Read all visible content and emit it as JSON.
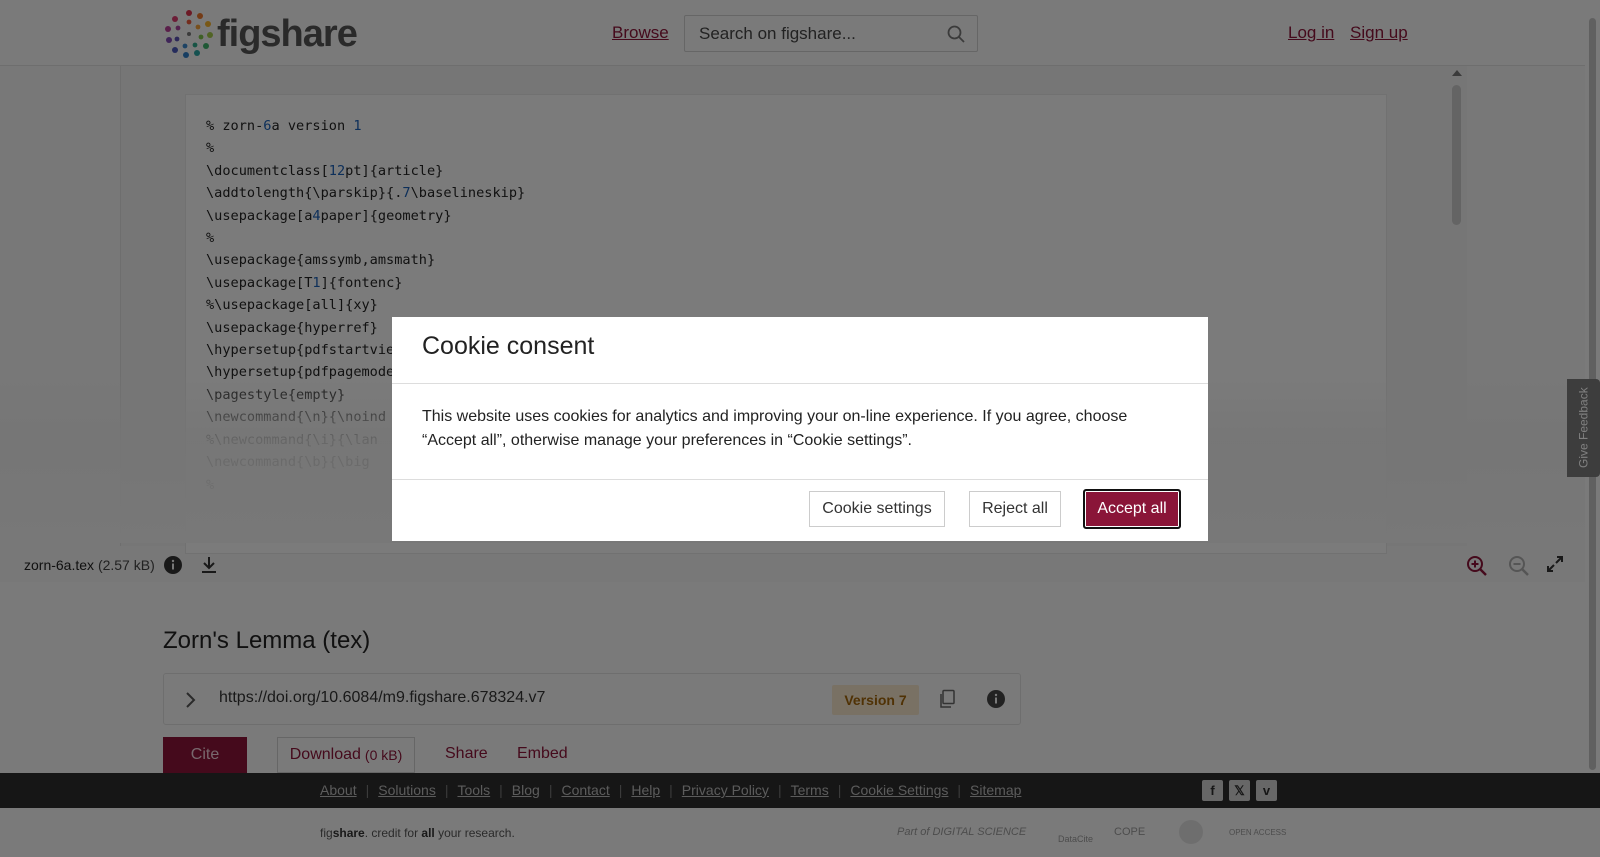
{
  "header": {
    "logo_text": "figshare",
    "browse": "Browse",
    "search_placeholder": "Search on figshare...",
    "login": "Log in",
    "signup": "Sign up"
  },
  "viewer": {
    "code_lines": [
      "% zorn-6a version 1",
      "%",
      "\\documentclass[12pt]{article}",
      "\\addtolength{\\parskip}{.7\\baselineskip}",
      "\\usepackage[a4paper]{geometry}",
      "%",
      "\\usepackage{amssymb,amsmath}",
      "\\usepackage[T1]{fontenc}",
      "%\\usepackage[all]{xy}",
      "\\usepackage{hyperref}",
      "\\hypersetup{pdfstartview",
      "\\hypersetup{pdfpagemode",
      "\\pagestyle{empty}",
      "\\newcommand{\\n}{\\noind",
      "%\\newcommand{\\i}{\\lan",
      "\\newcommand{\\b}{\\big",
      "%"
    ],
    "file_name": "zorn-6a.tex",
    "file_size": "(2.57 kB)"
  },
  "feedback": "Give Feedback",
  "item": {
    "title": "Zorn's Lemma (tex)",
    "doi": "https://doi.org/10.6084/m9.figshare.678324.v7",
    "version": "Version 7",
    "cite": "Cite",
    "download": "Download",
    "download_size": "(0 kB)",
    "share": "Share",
    "embed": "Embed"
  },
  "footer": {
    "links": [
      "About",
      "Solutions",
      "Tools",
      "Blog",
      "Contact",
      "Help",
      "Privacy Policy",
      "Terms",
      "Cookie Settings",
      "Sitemap"
    ],
    "tagline_fig": "fig",
    "tagline_share": "share",
    "tagline_mid": ". credit for ",
    "tagline_all": "all",
    "tagline_end": " your research.",
    "partner_ds": "Part of DIGITAL SCIENCE",
    "partner_datacite": "DataCite",
    "partner_cope": "COPE",
    "partner_oa": "OPEN ACCESS"
  },
  "cookie": {
    "title": "Cookie consent",
    "body": "This website uses cookies for analytics and improving your on-line experience. If you agree, choose “Accept all”, otherwise manage your preferences in “Cookie settings”.",
    "settings": "Cookie settings",
    "reject": "Reject all",
    "accept": "Accept all"
  },
  "colors": {
    "brand": "#8a1538",
    "version_bg": "#f3e3c8",
    "version_text": "#a0640a",
    "footer_bg": "#2d2d2d"
  }
}
